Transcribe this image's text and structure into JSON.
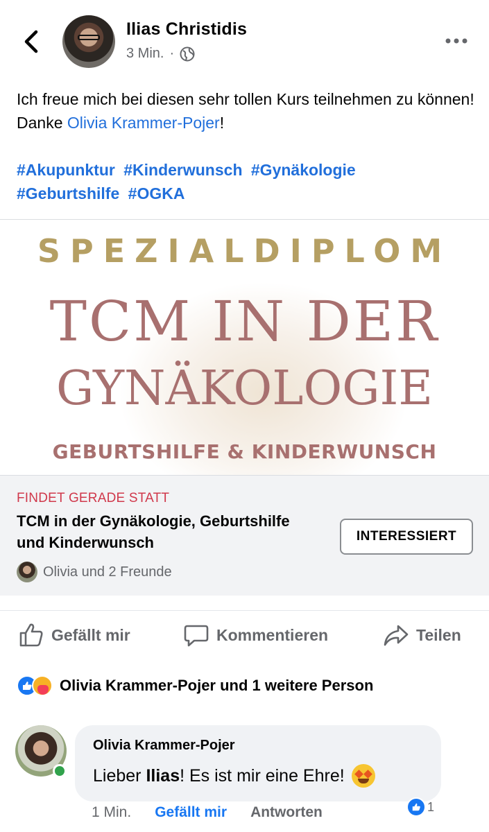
{
  "post": {
    "author": "Ilias Christidis",
    "time": "3 Min.",
    "separator": "·",
    "text_before": "Ich freue mich bei diesen sehr tollen Kurs teilnehmen zu können! Danke ",
    "mention": "Olivia Krammer-Pojer",
    "text_after": "!",
    "hashtags": [
      "#Akupunktur",
      "#Kinderwunsch",
      "#Gynäkologie",
      "#Geburtshilfe",
      "#OGKA"
    ]
  },
  "event": {
    "image": {
      "line1": "SPEZIALDIPLOM",
      "line2": "TCM IN DER",
      "line3": "GYNÄKOLOGIE",
      "line4": "GEBURTSHILFE & KINDERWUNSCH"
    },
    "status": "FINDET GERADE STATT",
    "title": "TCM in der Gynäkologie, Geburtshilfe und Kinderwunsch",
    "button_label": "INTERESSIERT",
    "friends_text": "Olivia und 2 Freunde"
  },
  "actions": {
    "like": "Gefällt mir",
    "comment": "Kommentieren",
    "share": "Teilen"
  },
  "reactions": {
    "icons": [
      "like-reaction",
      "care-reaction"
    ],
    "text": "Olivia Krammer-Pojer und 1 weitere Person"
  },
  "comment": {
    "author": "Olivia Krammer-Pojer",
    "text_before": "Lieber ",
    "mention": "Ilias",
    "text_after": "! Es ist mir eine Ehre!",
    "emoji": "star-struck-emoji",
    "time": "1 Min.",
    "like_label": "Gefällt mir",
    "reply_label": "Antworten",
    "reaction_count": "1"
  },
  "colors": {
    "link": "#216fdb",
    "accent": "#1877f2",
    "event_status": "#d0384b",
    "image_gold": "#b59f63",
    "image_rose": "#a8706f"
  }
}
